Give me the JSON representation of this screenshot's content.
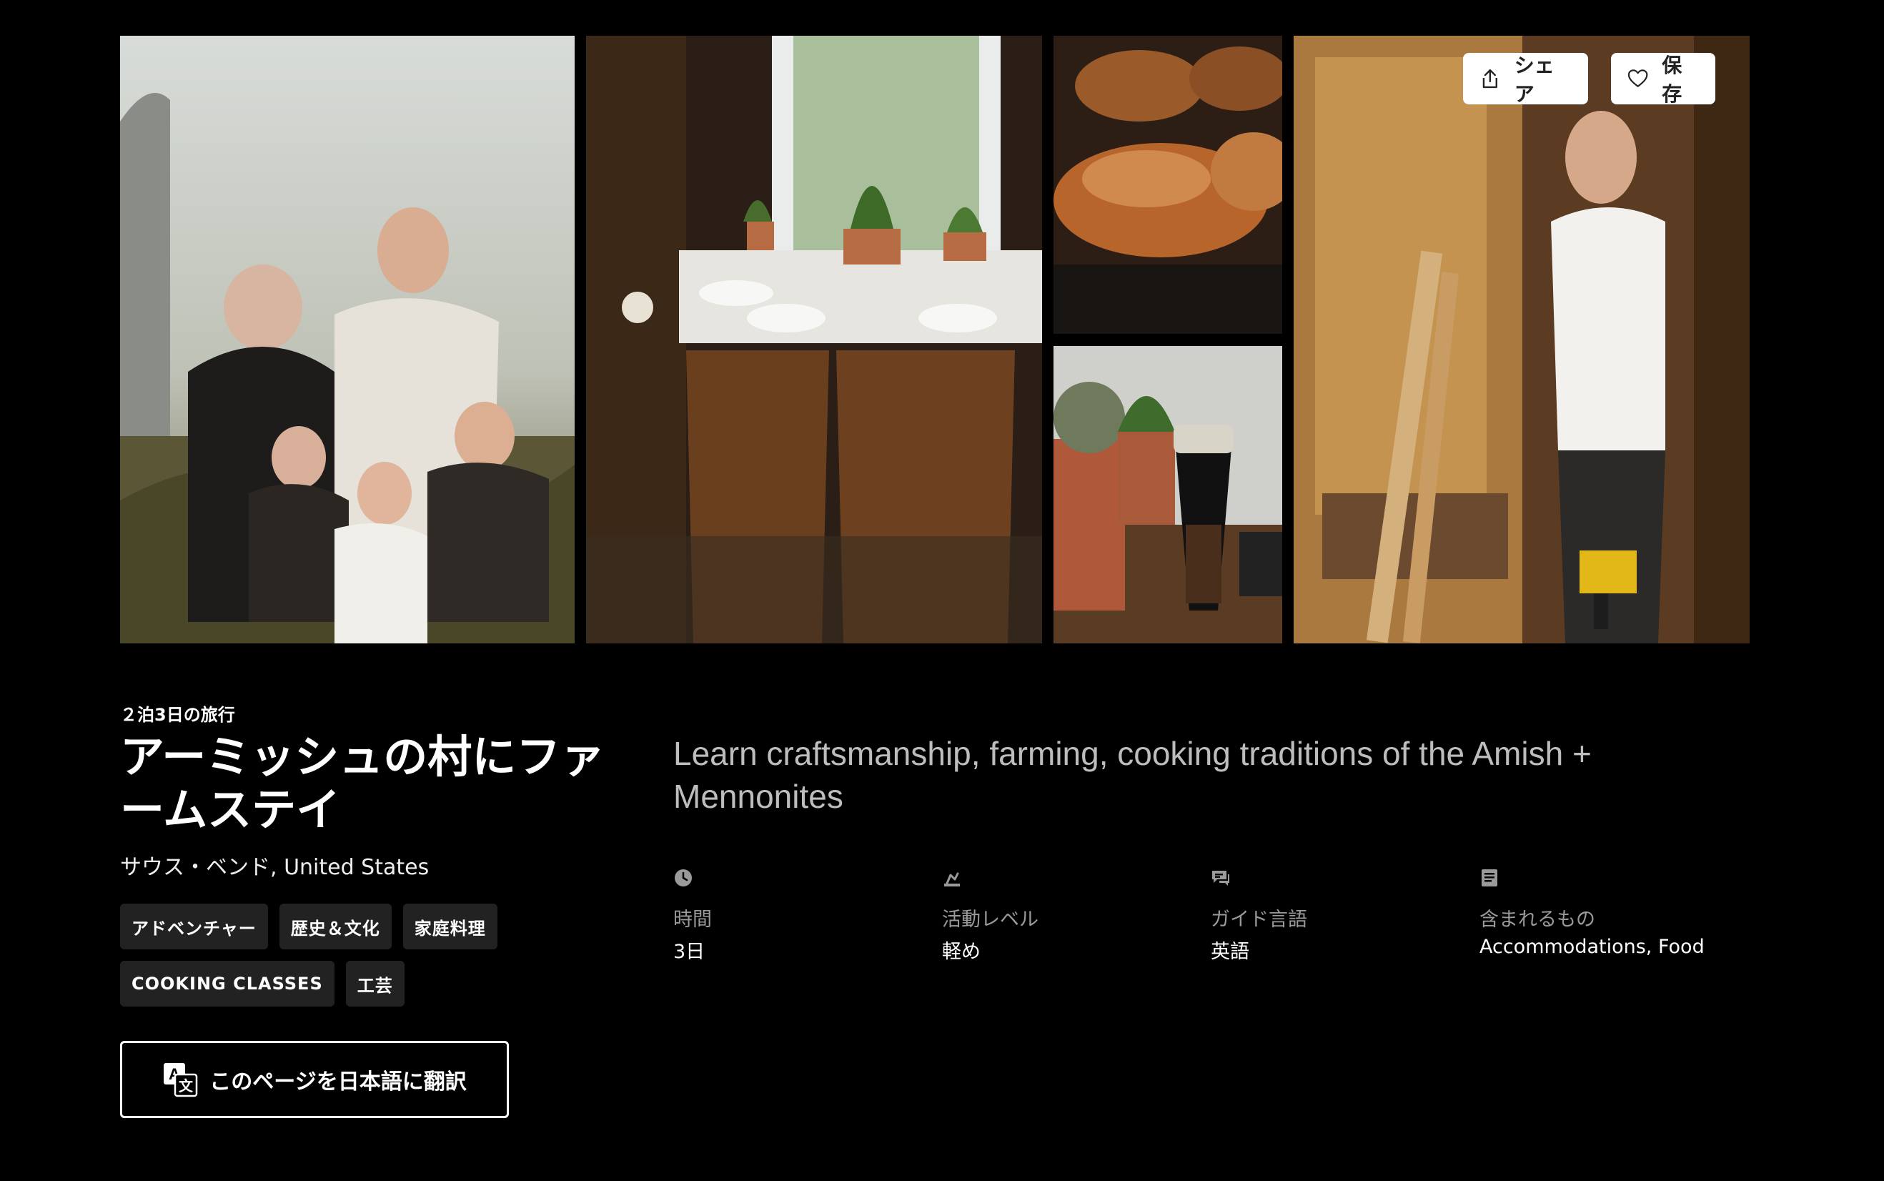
{
  "gallery": {
    "photos": [
      {
        "name": "family-photo"
      },
      {
        "name": "dining-table-photo"
      },
      {
        "name": "pastries-photo"
      },
      {
        "name": "coffee-brewer-photo"
      },
      {
        "name": "craftsman-photo"
      }
    ],
    "share_label": "シェア",
    "save_label": "保存"
  },
  "trip": {
    "duration_label": "２泊3日の旅行",
    "title": "アーミッシュの村にファームステイ",
    "location": "サウス・ベンド, United States",
    "tags": [
      "アドベンチャー",
      "歴史＆文化",
      "家庭料理",
      "COOKING CLASSES",
      "工芸"
    ],
    "translate_label": "このページを日本語に翻訳",
    "description": "Learn craftsmanship, farming, cooking traditions of the Amish + Mennonites"
  },
  "facts": [
    {
      "icon": "clock-icon",
      "label": "時間",
      "value": "3日"
    },
    {
      "icon": "activity-level-icon",
      "label": "活動レベル",
      "value": "軽め"
    },
    {
      "icon": "chat-bubble-icon",
      "label": "ガイド言語",
      "value": "英語"
    },
    {
      "icon": "receipt-icon",
      "label": "含まれるもの",
      "value": "Accommodations, Food"
    }
  ]
}
